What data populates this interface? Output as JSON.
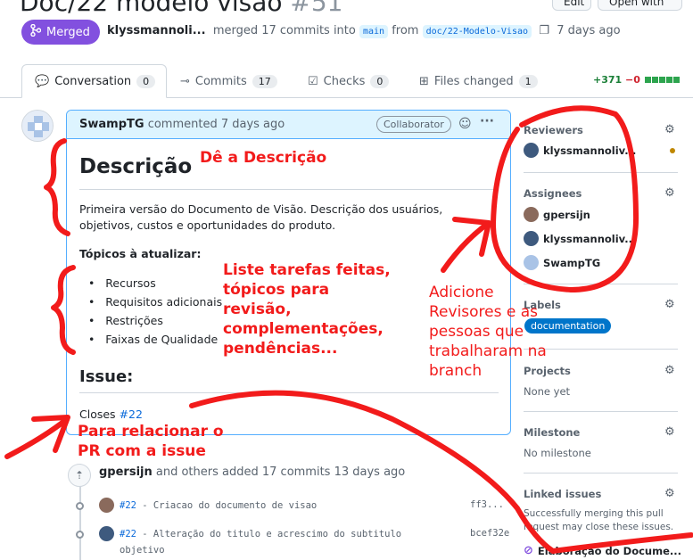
{
  "header": {
    "title": "Doc/22 modelo visão",
    "number": "#51",
    "edit_label": "Edit",
    "open_with_label": "Open with",
    "status": "Merged",
    "author": "klyssmannoli...",
    "merged_text": "merged 17 commits into",
    "base_branch": "main",
    "from_text": "from",
    "head_branch": "doc/22-Modelo-Visao",
    "time": "7 days ago"
  },
  "tabs": [
    {
      "label": "Conversation",
      "count": "0"
    },
    {
      "label": "Commits",
      "count": "17"
    },
    {
      "label": "Checks",
      "count": "0"
    },
    {
      "label": "Files changed",
      "count": "1"
    }
  ],
  "diffstat": {
    "additions": "+371",
    "deletions": "−0"
  },
  "comment": {
    "author": "SwampTG",
    "action": "commented 7 days ago",
    "badge": "Collaborator",
    "heading": "Descrição",
    "paragraph": "Primeira versão do Documento de Visão. Descrição dos usuários, objetivos, custos e oportunidades do produto.",
    "topics_heading": "Tópicos à atualizar:",
    "topics": [
      "Recursos",
      "Requisitos adicionais",
      "Restrições",
      "Faixas de Qualidade"
    ],
    "issue_heading": "Issue:",
    "closes_text": "Closes",
    "closes_ref": "#22"
  },
  "timeline": {
    "author": "gpersijn",
    "text": "and others added 17 commits 13 days ago",
    "commits": [
      {
        "ref": "#22",
        "message": " - Criacao do documento de visao",
        "sha": "ff3..."
      },
      {
        "ref": "#22",
        "message": " - Alteração do titulo e acrescimo do subtitulo",
        "message_line2": "objetivo",
        "sha": "bcef32e"
      }
    ]
  },
  "sidebar": {
    "reviewers_heading": "Reviewers",
    "reviewers": [
      "klyssmannoliv..."
    ],
    "assignees_heading": "Assignees",
    "assignees": [
      "gpersijn",
      "klyssmannoliv...",
      "SwampTG"
    ],
    "labels_heading": "Labels",
    "label": "documentation",
    "projects_heading": "Projects",
    "projects_value": "None yet",
    "milestone_heading": "Milestone",
    "milestone_value": "No milestone",
    "linked_heading": "Linked issues",
    "linked_text_1": "Successfully merging this pull",
    "linked_text_2": "request may close these issues.",
    "linked_issue": "Elaboração do Docume..."
  },
  "annotations": {
    "desc": "Dê a Descrição",
    "tasks": [
      "Liste tarefas feitas,",
      "tópicos para",
      "revisão,",
      "complementações,",
      "pendências..."
    ],
    "reviewers": [
      "Adicione",
      "Revisores e as",
      "pessoas que",
      "trabalharam na",
      "branch"
    ],
    "issue": [
      "Para relacionar o",
      "PR com a issue"
    ]
  },
  "colors": {
    "merged": "#8250df",
    "annotation": "#f21b1b",
    "label_documentation": "#0075ca",
    "link": "#0969da"
  }
}
